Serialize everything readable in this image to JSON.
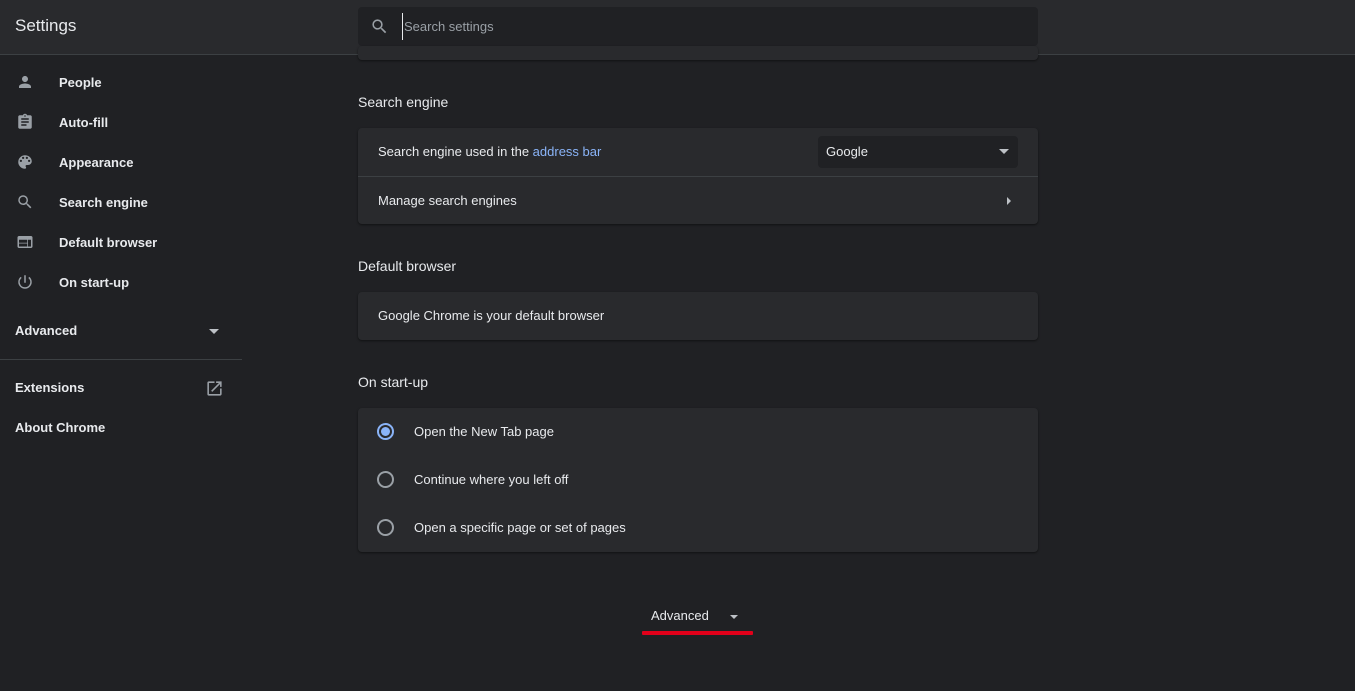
{
  "header": {
    "title": "Settings",
    "search_placeholder": "Search settings"
  },
  "sidebar": {
    "items": [
      {
        "label": "People",
        "icon": "person-icon"
      },
      {
        "label": "Auto-fill",
        "icon": "clipboard-icon"
      },
      {
        "label": "Appearance",
        "icon": "palette-icon"
      },
      {
        "label": "Search engine",
        "icon": "search-icon"
      },
      {
        "label": "Default browser",
        "icon": "browser-window-icon"
      },
      {
        "label": "On start-up",
        "icon": "power-icon"
      }
    ],
    "advanced_label": "Advanced",
    "extensions_label": "Extensions",
    "about_label": "About Chrome"
  },
  "search_engine": {
    "title": "Search engine",
    "used_in_prefix": "Search engine used in the ",
    "used_in_link": "address bar",
    "selected": "Google",
    "manage_label": "Manage search engines"
  },
  "default_browser": {
    "title": "Default browser",
    "status": "Google Chrome is your default browser"
  },
  "startup": {
    "title": "On start-up",
    "options": [
      {
        "label": "Open the New Tab page",
        "checked": true
      },
      {
        "label": "Continue where you left off",
        "checked": false
      },
      {
        "label": "Open a specific page or set of pages",
        "checked": false
      }
    ]
  },
  "advanced_toggle": {
    "label": "Advanced",
    "highlight_color": "#e2001a"
  },
  "colors": {
    "background": "#202124",
    "surface": "#292a2d",
    "accent": "#8ab4f8"
  }
}
